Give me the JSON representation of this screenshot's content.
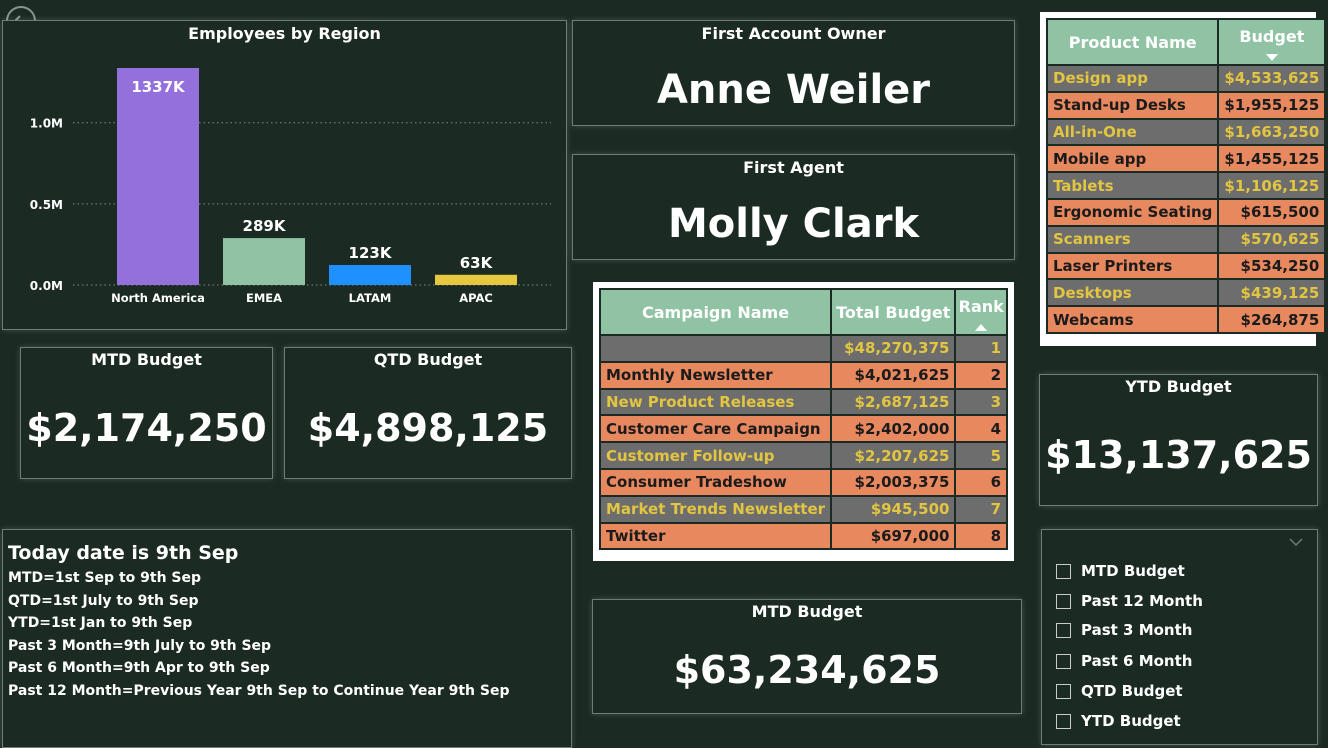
{
  "chart_data": {
    "type": "bar",
    "title": "Employees by Region",
    "categories": [
      "North America",
      "EMEA",
      "LATAM",
      "APAC"
    ],
    "values": [
      1337000,
      289000,
      123000,
      63000
    ],
    "data_labels": [
      "1337K",
      "289K",
      "123K",
      "63K"
    ],
    "colors": [
      "#9370db",
      "#8fc3a3",
      "#1e90ff",
      "#e6c83e"
    ],
    "ylim": [
      0,
      1337000
    ],
    "yticks": [
      0,
      500000,
      1000000
    ],
    "ytick_labels": [
      "0.0M",
      "0.5M",
      "1.0M"
    ],
    "grid": true
  },
  "first_account_owner": {
    "title": "First Account Owner",
    "value": "Anne Weiler"
  },
  "first_agent": {
    "title": "First Agent",
    "value": "Molly Clark"
  },
  "mtd_budget": {
    "title": "MTD Budget",
    "value": "$2,174,250"
  },
  "qtd_budget": {
    "title": "QTD Budget",
    "value": "$4,898,125"
  },
  "ytd_budget": {
    "title": "YTD Budget",
    "value": "$13,137,625"
  },
  "mtd_budget_total": {
    "title": "MTD Budget",
    "value": "$63,234,625"
  },
  "product_table": {
    "headers": [
      "Product Name",
      "Budget"
    ],
    "sorted_column": "Budget",
    "sort_direction": "descending",
    "rows": [
      [
        "Design app",
        "$4,533,625"
      ],
      [
        "Stand-up Desks",
        "$1,955,125"
      ],
      [
        "All-in-One",
        "$1,663,250"
      ],
      [
        "Mobile app",
        "$1,455,125"
      ],
      [
        "Tablets",
        "$1,106,125"
      ],
      [
        "Ergonomic Seating",
        "$615,500"
      ],
      [
        "Scanners",
        "$570,625"
      ],
      [
        "Laser Printers",
        "$534,250"
      ],
      [
        "Desktops",
        "$439,125"
      ],
      [
        "Webcams",
        "$264,875"
      ]
    ]
  },
  "campaign_table": {
    "headers": [
      "Campaign Name",
      "Total Budget",
      "Rank"
    ],
    "sorted_column": "Rank",
    "sort_direction": "ascending",
    "rows": [
      [
        "",
        "$48,270,375",
        "1"
      ],
      [
        "Monthly Newsletter",
        "$4,021,625",
        "2"
      ],
      [
        "New Product Releases",
        "$2,687,125",
        "3"
      ],
      [
        "Customer Care Campaign",
        "$2,402,000",
        "4"
      ],
      [
        "Customer Follow-up",
        "$2,207,625",
        "5"
      ],
      [
        "Consumer Tradeshow",
        "$2,003,375",
        "6"
      ],
      [
        "Market Trends Newsletter",
        "$945,500",
        "7"
      ],
      [
        "Twitter",
        "$697,000",
        "8"
      ]
    ]
  },
  "info": {
    "heading": "Today date is  9th Sep",
    "lines": [
      "MTD=1st  Sep to 9th Sep",
      "QTD=1st July to 9th Sep",
      "YTD=1st Jan to 9th Sep",
      "Past 3 Month=9th July to 9th Sep",
      "Past 6 Month=9th Apr to 9th Sep",
      "Past 12 Month=Previous Year 9th Sep to Continue Year 9th Sep"
    ]
  },
  "slicer": {
    "items": [
      "MTD Budget",
      "Past 12 Month",
      "Past 3 Month",
      "Past 6 Month",
      "QTD Budget",
      "YTD Budget"
    ],
    "icon": "chevron-down-icon"
  },
  "icons": {
    "back": "back-arrow-icon"
  },
  "colors": {
    "background": "#1b2a22",
    "header": "#8fc3a3",
    "row_alt_grey": "#6d6d6d",
    "row_alt_orange": "#e8885f",
    "highlight_text": "#e2c541"
  }
}
